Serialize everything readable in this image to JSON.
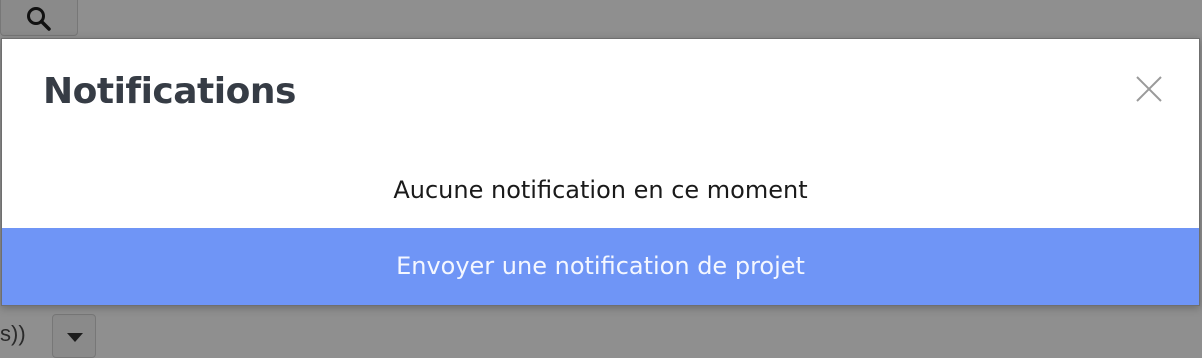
{
  "background": {
    "search_icon": "search-icon",
    "left_text": "s))",
    "dropdown_icon": "caret-down-icon"
  },
  "modal": {
    "title": "Notifications",
    "close_icon": "close-icon",
    "empty_message": "Aucune notification en ce moment",
    "send_button_label": "Envoyer une notification de projet"
  },
  "colors": {
    "overlay": "#8f8f8f",
    "modal_background": "#ffffff",
    "title": "#363c45",
    "primary_button": "#6f95f6",
    "primary_button_text": "#f4f7ff"
  }
}
